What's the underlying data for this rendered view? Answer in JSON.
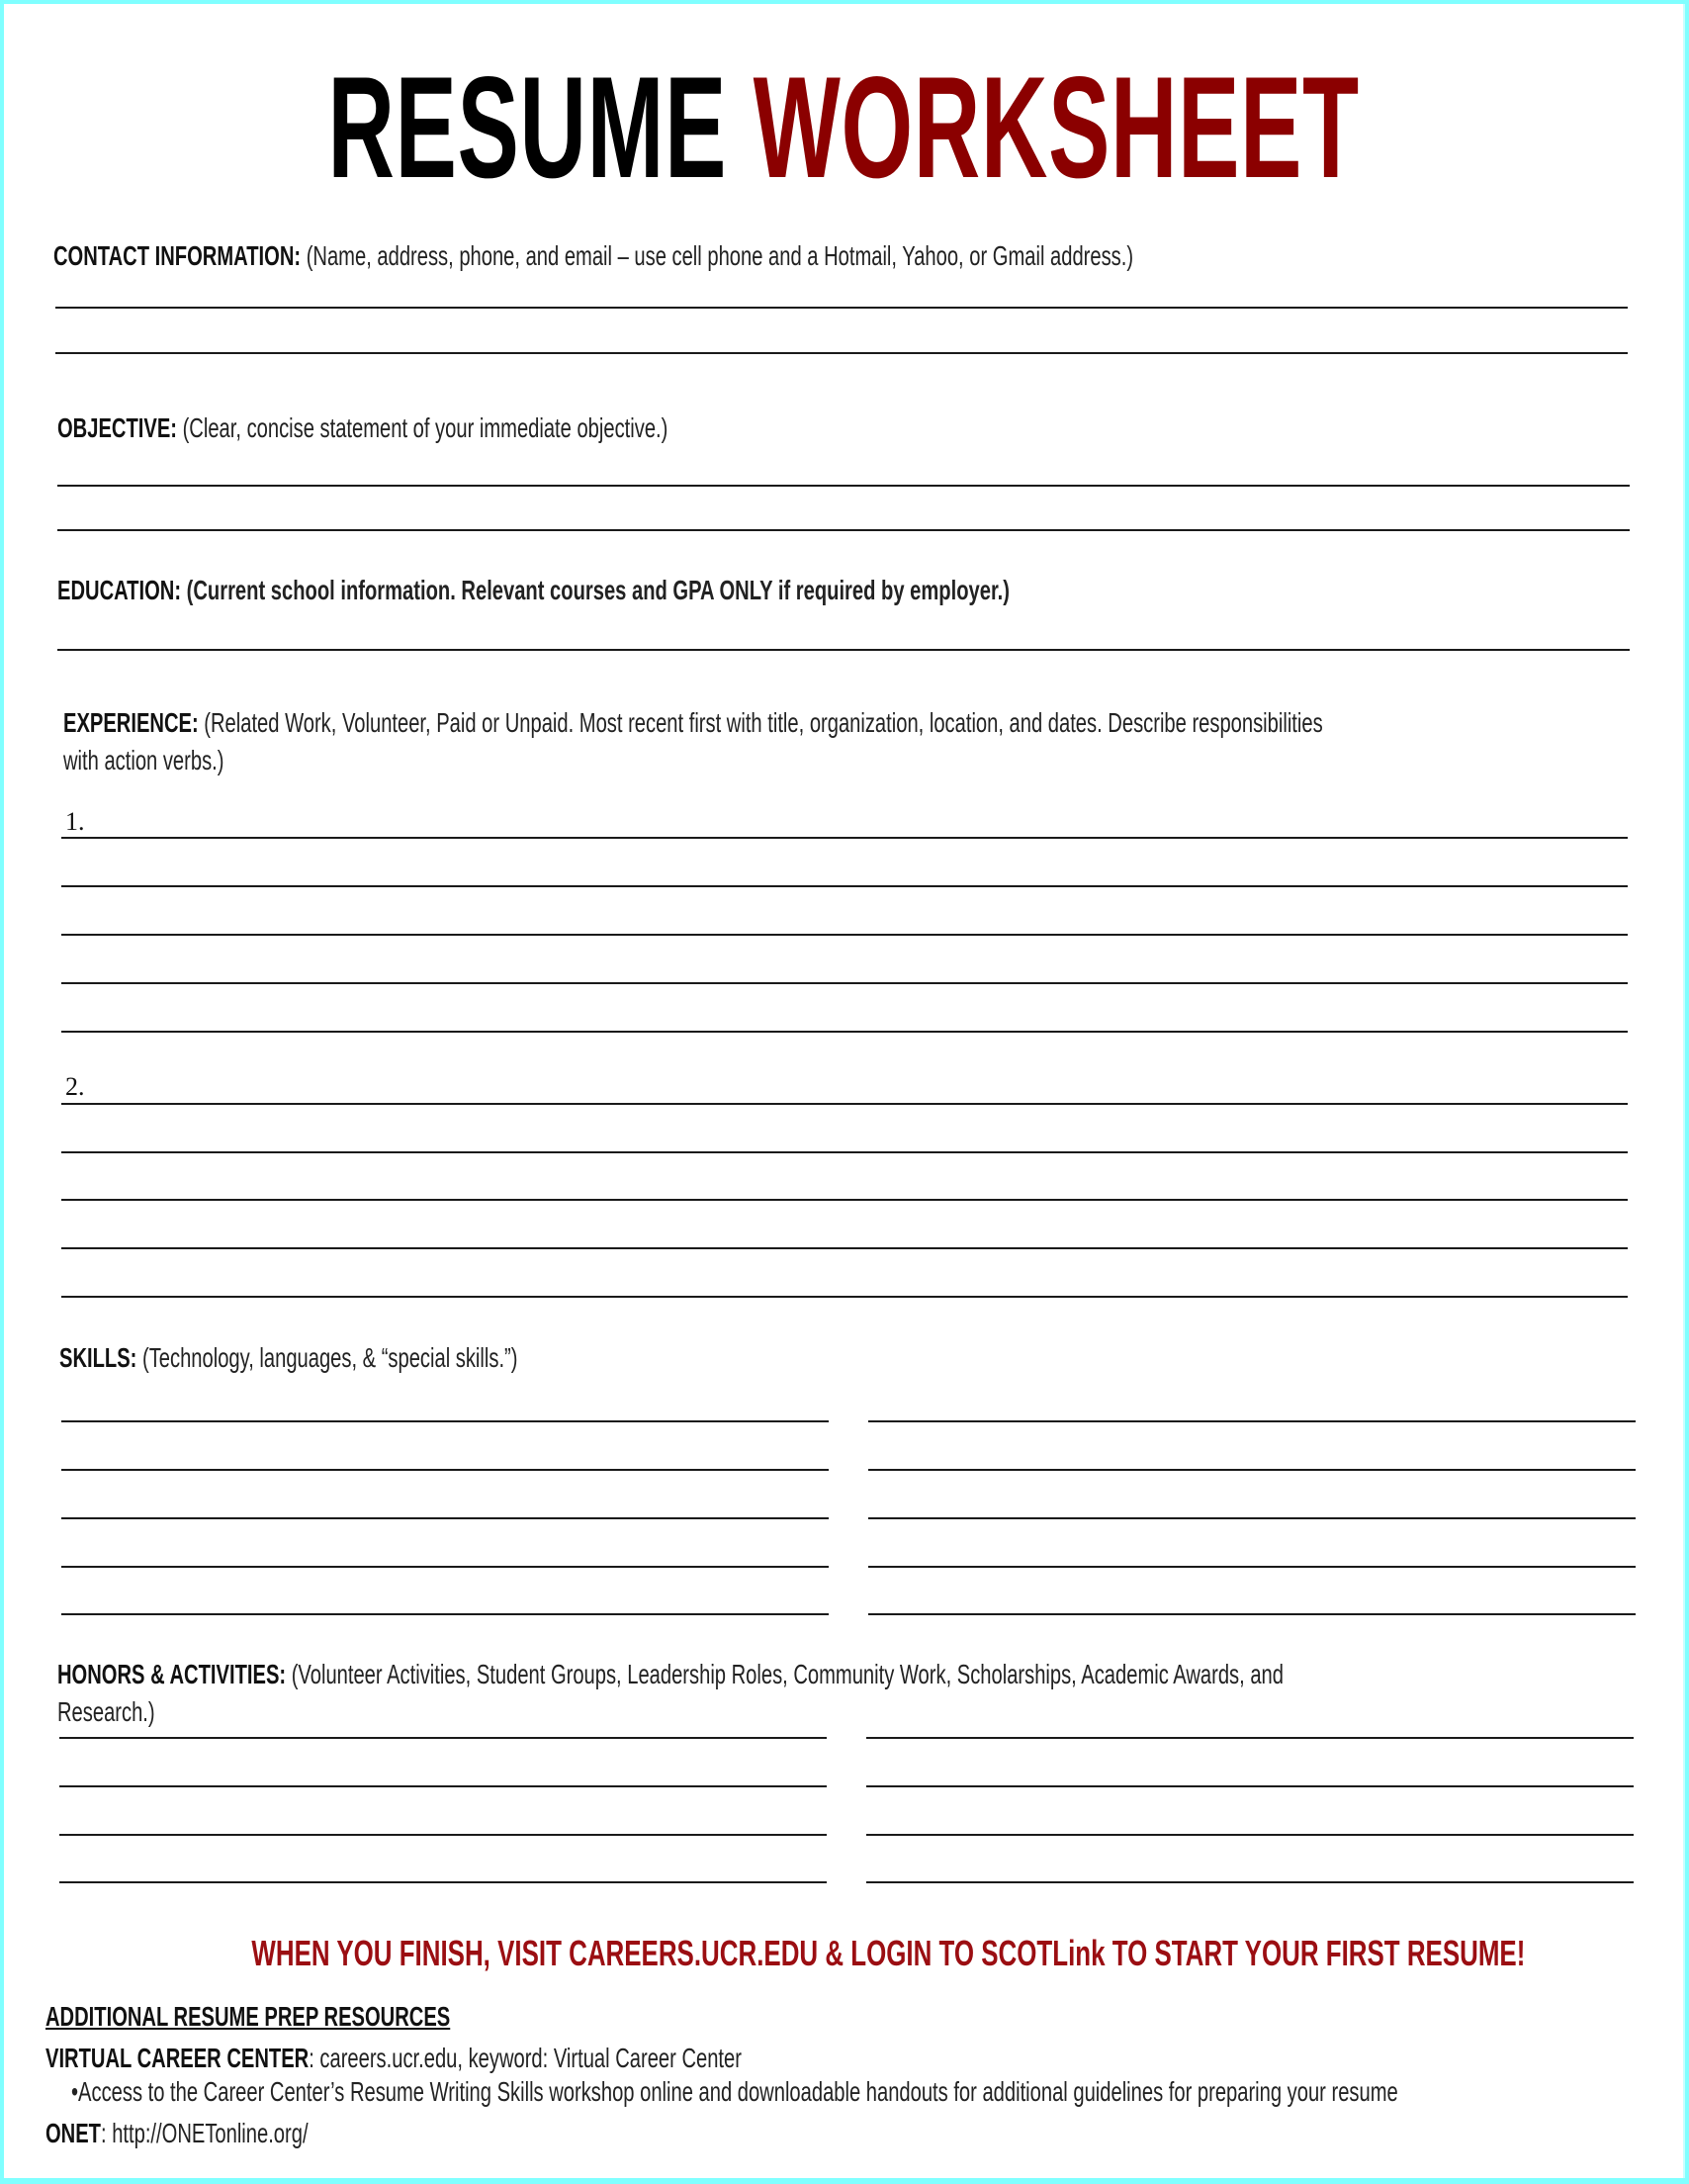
{
  "title": {
    "part1": "RESUME",
    "part2": "WORKSHEET"
  },
  "colors": {
    "accent_red": "#8b0000",
    "cta_red": "#9b0e12",
    "frame_cyan": "#80ffff"
  },
  "sections": {
    "contact": {
      "label": "CONTACT INFORMATION:",
      "note": "(Name, address, phone, and email – use cell phone and a Hotmail, Yahoo, or Gmail address.)"
    },
    "objective": {
      "label": "OBJECTIVE:",
      "note": "(Clear, concise statement of your immediate objective.)"
    },
    "education": {
      "label": "EDUCATION:",
      "note": "(Current school information.  Relevant courses and GPA ONLY if required by employer.)"
    },
    "experience": {
      "label": "EXPERIENCE:",
      "note_line1": "(Related Work, Volunteer, Paid or Unpaid. Most recent first with title, organization, location, and dates.  Describe responsibilities",
      "note_line2": "with action verbs.)",
      "entries": [
        "1.",
        "2."
      ]
    },
    "skills": {
      "label": "SKILLS:",
      "note": "(Technology, languages, & “special skills.”)"
    },
    "honors": {
      "label": "HONORS & ACTIVITIES:",
      "note_line1": "(Volunteer Activities, Student Groups, Leadership Roles, Community Work, Scholarships, Academic Awards, and",
      "note_line2": "Research.)"
    }
  },
  "call_to_action": "WHEN YOU FINISH, VISIT CAREERS.UCR.EDU & LOGIN TO SCOTLink TO START YOUR FIRST RESUME!",
  "resources": {
    "heading": "ADDITIONAL RESUME PREP RESOURCES",
    "virtual_career_center": {
      "label": "VIRTUAL CAREER CENTER",
      "value": ": careers.ucr.edu, keyword: Virtual Career Center",
      "bullet": "•Access to the Career Center’s Resume Writing Skills workshop online and downloadable handouts for additional guidelines for preparing your resume"
    },
    "onet": {
      "label": "ONET",
      "value": ": http://ONETonline.org/"
    }
  }
}
